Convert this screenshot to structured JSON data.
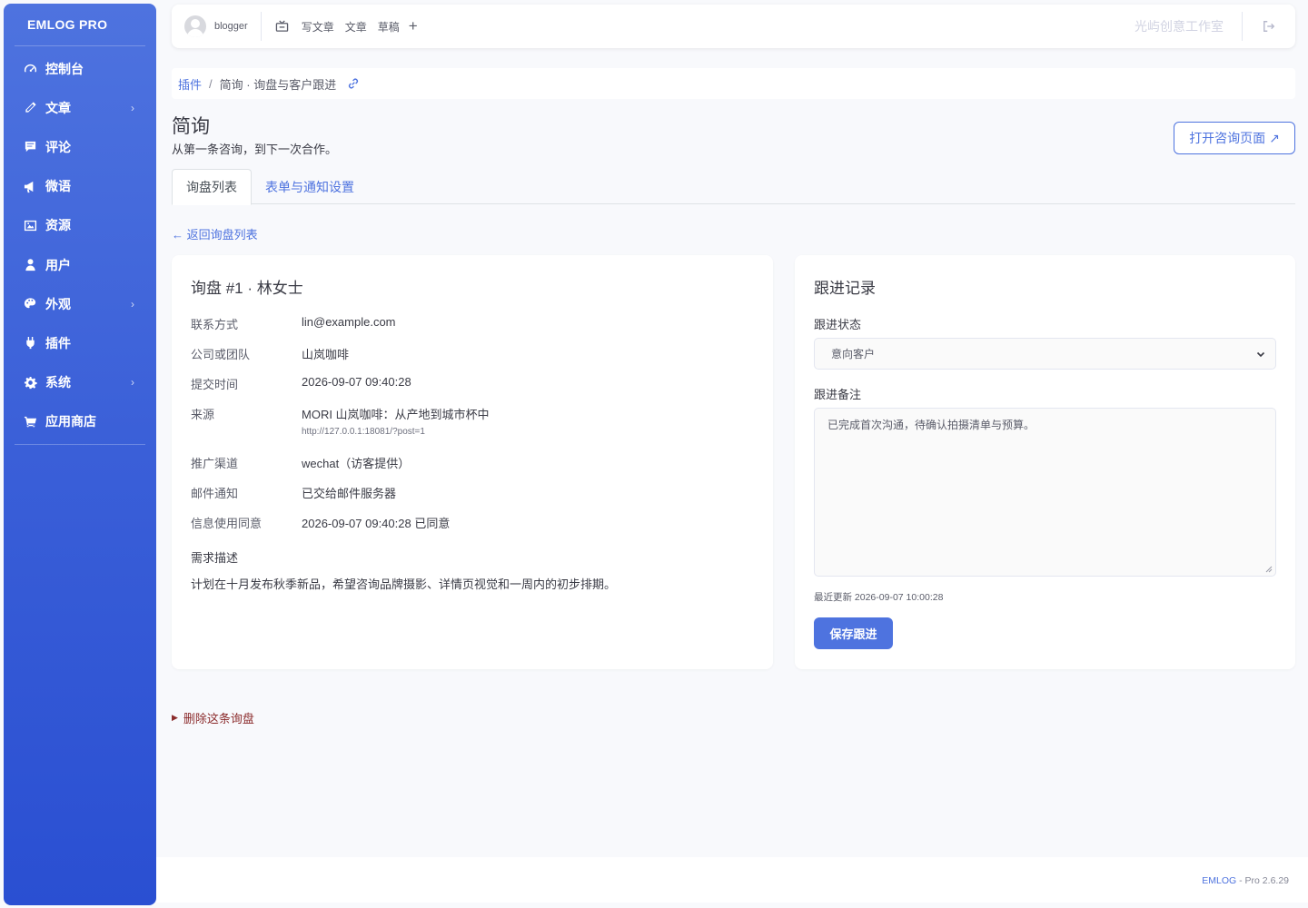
{
  "brand": "EMLOG PRO",
  "sidebar": {
    "items": [
      {
        "label": "控制台",
        "icon": "dashboard-icon",
        "has_sub": false
      },
      {
        "label": "文章",
        "icon": "pencil-icon",
        "has_sub": true
      },
      {
        "label": "评论",
        "icon": "comment-icon",
        "has_sub": false
      },
      {
        "label": "微语",
        "icon": "megaphone-icon",
        "has_sub": false
      },
      {
        "label": "资源",
        "icon": "image-icon",
        "has_sub": false
      },
      {
        "label": "用户",
        "icon": "user-icon",
        "has_sub": false
      },
      {
        "label": "外观",
        "icon": "palette-icon",
        "has_sub": true
      },
      {
        "label": "插件",
        "icon": "plug-icon",
        "has_sub": false
      },
      {
        "label": "系统",
        "icon": "gear-icon",
        "has_sub": true
      },
      {
        "label": "应用商店",
        "icon": "cart-icon",
        "has_sub": false
      }
    ]
  },
  "topbar": {
    "username": "blogger",
    "write": "写文章",
    "articles": "文章",
    "drafts": "草稿",
    "plus": "+",
    "site_name": "光屿创意工作室"
  },
  "breadcrumb": {
    "root": "插件",
    "sep": "/",
    "current": "简询 · 询盘与客户跟进"
  },
  "page": {
    "title": "简询",
    "subtitle": "从第一条咨询，到下一次合作。",
    "open_button": "打开咨询页面 ↗"
  },
  "tabs": [
    "询盘列表",
    "表单与通知设置"
  ],
  "back_link": "← 返回询盘列表",
  "inquiry": {
    "title": "询盘 #1 · 林女士",
    "rows": [
      {
        "label": "联系方式",
        "value": "lin@example.com"
      },
      {
        "label": "公司或团队",
        "value": "山岚咖啡"
      },
      {
        "label": "提交时间",
        "value": "2026-09-07 09:40:28"
      },
      {
        "label": "来源",
        "value": "MORI 山岚咖啡：从产地到城市杯中"
      },
      {
        "label": "推广渠道",
        "value": "wechat（访客提供）"
      },
      {
        "label": "邮件通知",
        "value": "已交给邮件服务器"
      },
      {
        "label": "信息使用同意",
        "value": "2026-09-07 09:40:28 已同意"
      }
    ],
    "source_url": "http://127.0.0.1:18081/?post=1",
    "requirement_title": "需求描述",
    "requirement_text": "计划在十月发布秋季新品，希望咨询品牌摄影、详情页视觉和一周内的初步排期。"
  },
  "followup": {
    "title": "跟进记录",
    "status_label": "跟进状态",
    "status_value": "意向客户",
    "note_label": "跟进备注",
    "note_value": "已完成首次沟通，待确认拍摄清单与预算。",
    "updated": "最近更新 2026-09-07 10:00:28",
    "save_button": "保存跟进"
  },
  "delete_toggle": "删除这条询盘",
  "footer": {
    "link": "EMLOG",
    "version": " - Pro 2.6.29"
  },
  "colors": {
    "primary": "#4e73df",
    "danger_text": "#8b2b2b"
  }
}
